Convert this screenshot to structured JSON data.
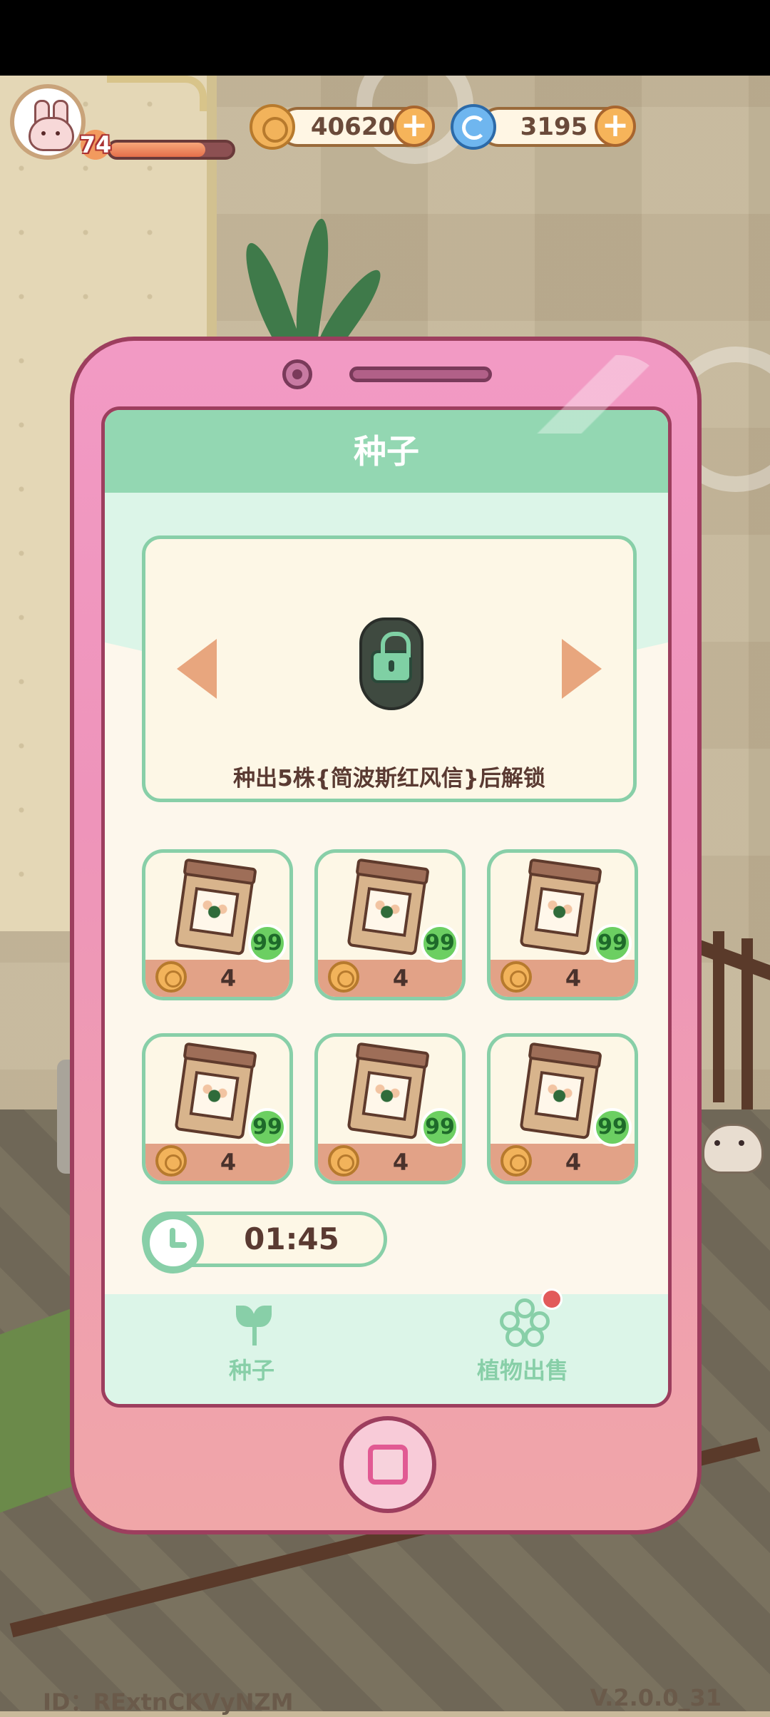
{
  "hud": {
    "level": "74",
    "level_progress": 0.78,
    "coins": "40620",
    "gems": "3195",
    "coin_icon": "coin-icon",
    "gem_icon": "swirl-icon"
  },
  "panel": {
    "title": "种子",
    "locked_seed": {
      "icon": "lock-icon",
      "unlock_text": "种出5株{简波斯红风信}后解锁"
    },
    "seed_slots": [
      {
        "qty": "99",
        "price": "4"
      },
      {
        "qty": "99",
        "price": "4"
      },
      {
        "qty": "99",
        "price": "4"
      },
      {
        "qty": "99",
        "price": "4"
      },
      {
        "qty": "99",
        "price": "4"
      },
      {
        "qty": "99",
        "price": "4"
      }
    ],
    "timer": "01:45",
    "tabs": [
      {
        "label": "种子",
        "icon": "sprout-icon",
        "active": true
      },
      {
        "label": "植物出售",
        "icon": "flower-icon",
        "active": false,
        "notification": true
      }
    ]
  },
  "footer": {
    "id_text": "ID：RExtnCKVyNZM",
    "version": "V.2.0.0_31"
  },
  "colors": {
    "phone_pink": "#f29ac4",
    "mint": "#93d7b2",
    "mint_border": "#88cfa8",
    "price_bar": "#e2a287"
  }
}
